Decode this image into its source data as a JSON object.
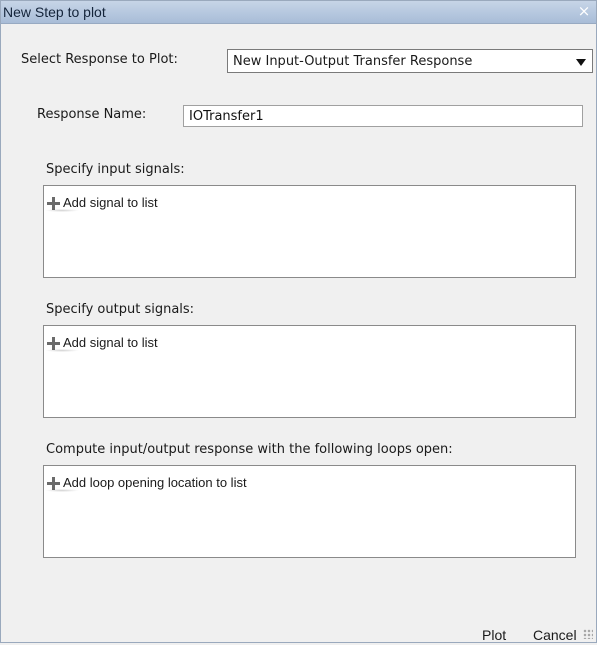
{
  "window": {
    "title": "New Step to plot",
    "close_glyph": "×"
  },
  "response_select": {
    "label": "Select Response to Plot:",
    "value": "New Input-Output Transfer Response"
  },
  "response_name": {
    "label": "Response Name:",
    "value": "IOTransfer1"
  },
  "input_signals": {
    "label": "Specify input signals:",
    "add_label": "Add signal to list",
    "add_icon": "plus-icon"
  },
  "output_signals": {
    "label": "Specify output signals:",
    "add_label": "Add signal to list",
    "add_icon": "plus-icon"
  },
  "loops": {
    "label": "Compute input/output response with the following loops open:",
    "add_label": "Add loop opening location to list",
    "add_icon": "plus-icon"
  },
  "buttons": {
    "plot": "Plot",
    "cancel": "Cancel"
  },
  "colors": {
    "titlebar": "#b4c6de",
    "background": "#f0f0f0"
  }
}
